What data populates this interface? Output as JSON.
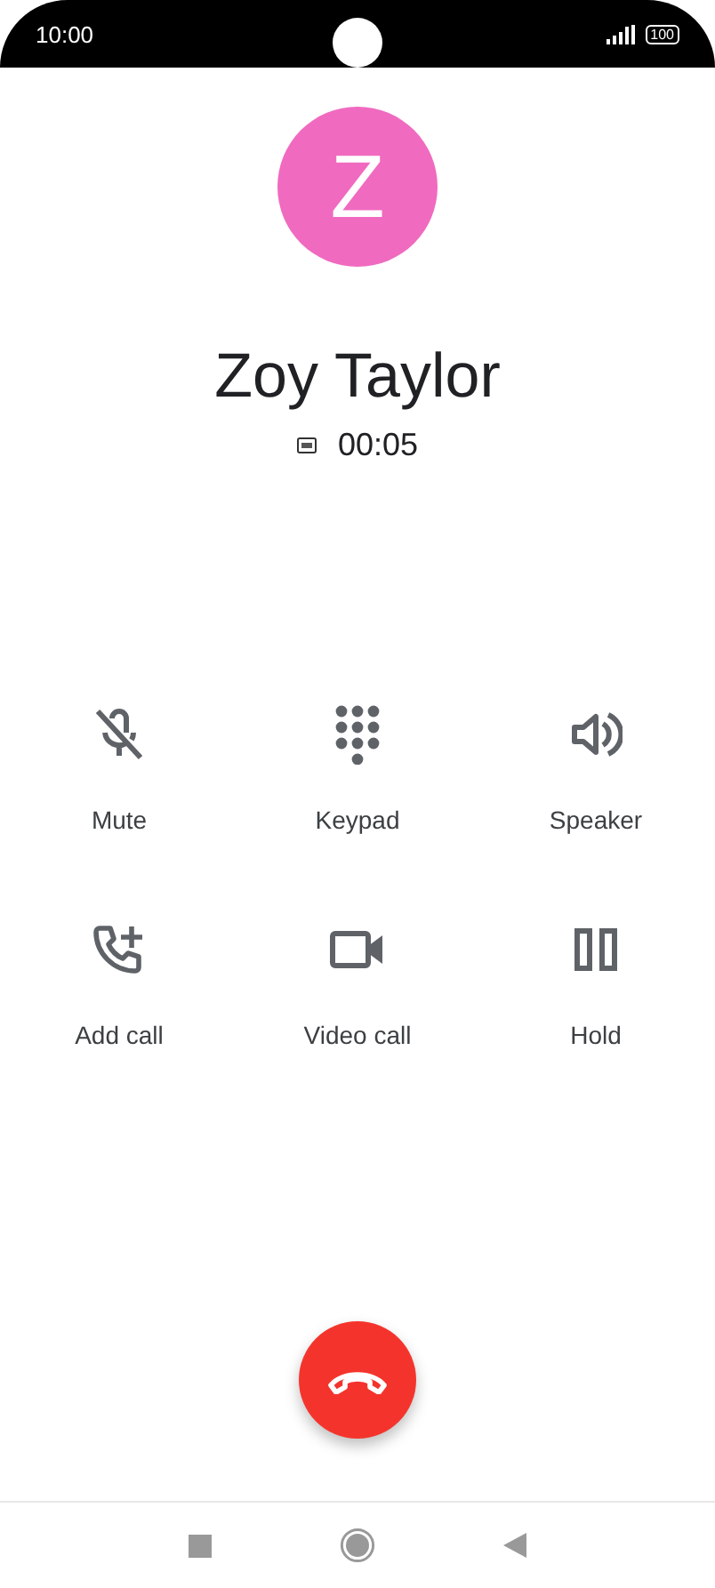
{
  "status_bar": {
    "time": "10:00",
    "battery": "100"
  },
  "contact": {
    "initial": "Z",
    "color": "#f06ac0",
    "name": "Zoy Taylor",
    "duration": "00:05"
  },
  "actions": [
    {
      "kind": "mute",
      "label": "Mute"
    },
    {
      "kind": "keypad",
      "label": "Keypad"
    },
    {
      "kind": "speaker",
      "label": "Speaker"
    },
    {
      "kind": "add_call",
      "label": "Add call"
    },
    {
      "kind": "video",
      "label": "Video call"
    },
    {
      "kind": "hold",
      "label": "Hold"
    }
  ]
}
